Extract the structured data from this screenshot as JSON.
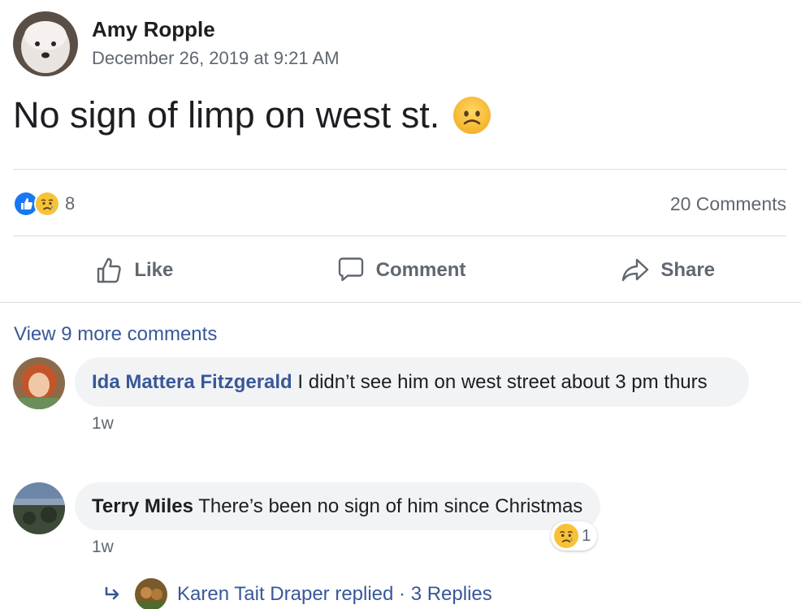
{
  "post": {
    "author": "Amy Ropple",
    "date": "December 26, 2019 at 9:21 AM",
    "text": "No sign of limp on west st.",
    "emoji": "frowning-face-emoji",
    "reactions": {
      "icons": [
        "like-reaction-icon",
        "sad-reaction-icon"
      ],
      "count": "8"
    },
    "comments_count": "20 Comments"
  },
  "actions": {
    "like": "Like",
    "comment": "Comment",
    "share": "Share"
  },
  "view_more": "View 9 more comments",
  "comments": [
    {
      "name": "Ida Mattera Fitzgerald",
      "text": "I didn’t see him on west street about 3 pm thurs",
      "time": "1w"
    },
    {
      "name": "Terry Miles",
      "text": "There’s been no sign of him since Christmas",
      "time": "1w",
      "reaction_count": "1"
    }
  ],
  "replies": {
    "text": "Karen Tait Draper replied · 3 Replies"
  },
  "colors": {
    "link": "#385898",
    "secondary": "#606770",
    "bubble": "#f2f3f5",
    "like_blue": "#1877f2",
    "divider": "#dadde1"
  }
}
